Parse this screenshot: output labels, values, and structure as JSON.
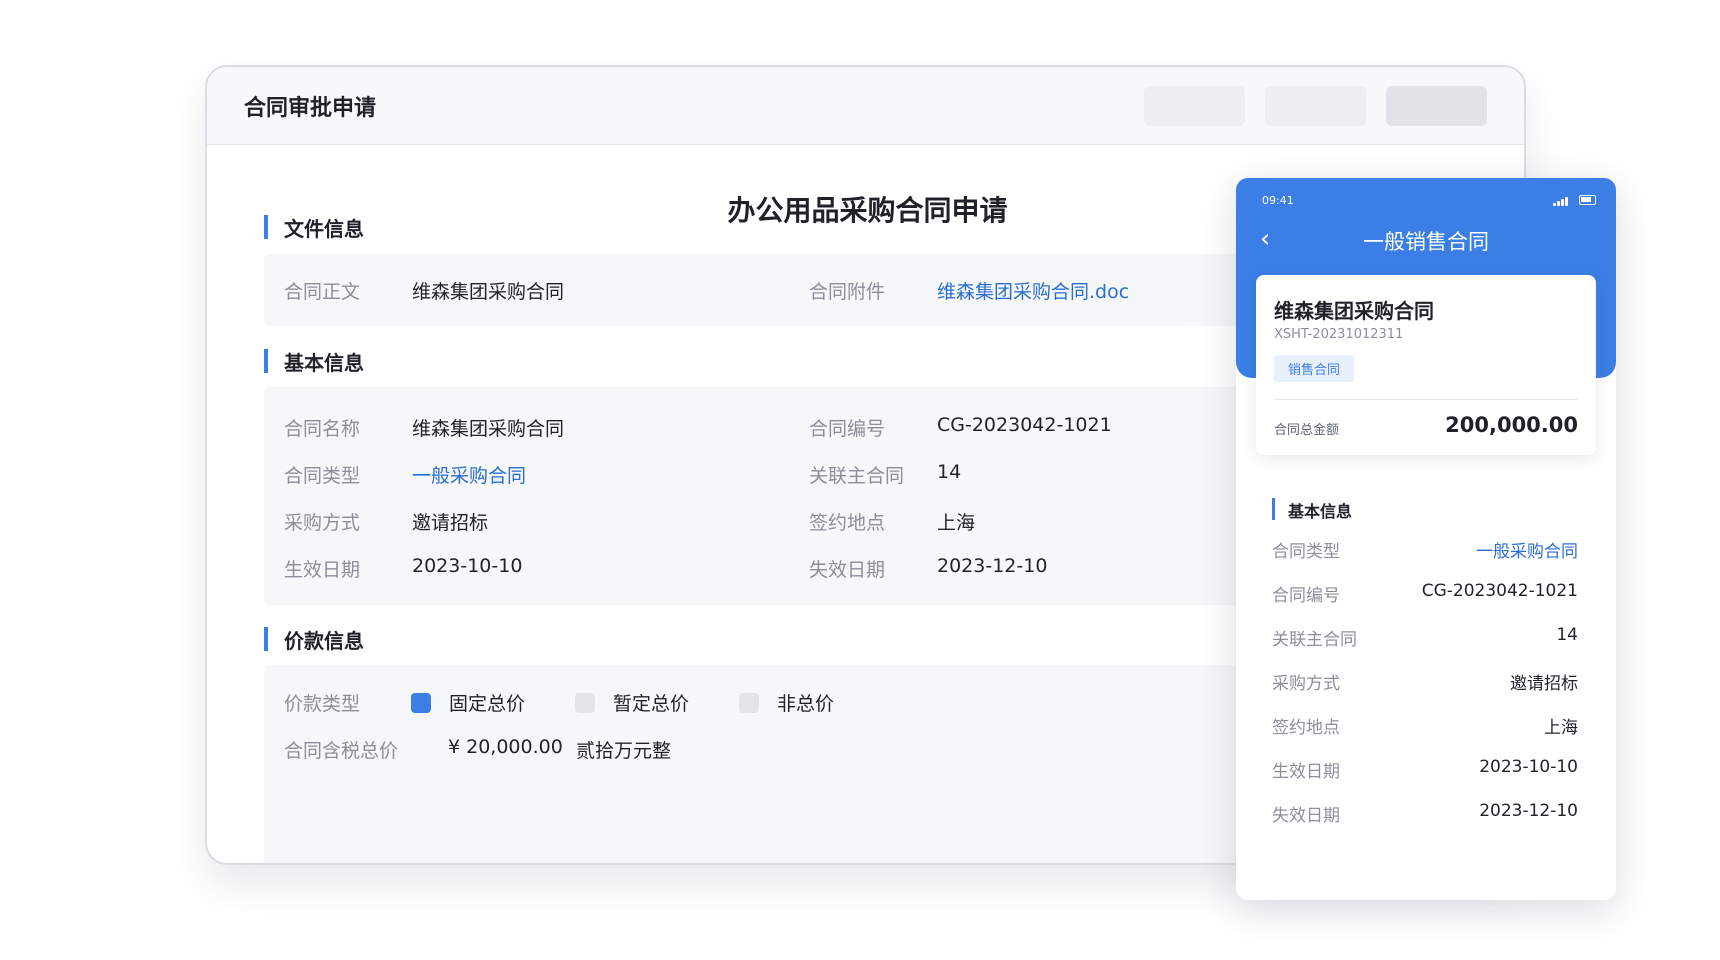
{
  "window": {
    "title": "合同审批申请",
    "doc_title": "办公用品采购合同申请"
  },
  "file_section": {
    "title": "文件信息",
    "body_label": "合同正文",
    "body_value": "维森集团采购合同",
    "attach_label": "合同附件",
    "attach_value": "维森集团采购合同.doc"
  },
  "basic_section": {
    "title": "基本信息",
    "fields": [
      {
        "label": "合同名称",
        "value": "维森集团采购合同"
      },
      {
        "label": "合同编号",
        "value": "CG-2023042-1021"
      },
      {
        "label": "合同类型",
        "value": "一般采购合同"
      },
      {
        "label": "关联主合同",
        "value": "14"
      },
      {
        "label": "采购方式",
        "value": "邀请招标"
      },
      {
        "label": "签约地点",
        "value": "上海"
      },
      {
        "label": "生效日期",
        "value": "2023-10-10"
      },
      {
        "label": "失效日期",
        "value": "2023-12-10"
      }
    ]
  },
  "price_section": {
    "title": "价款信息",
    "type_label": "价款类型",
    "options": [
      {
        "label": "固定总价",
        "checked": true
      },
      {
        "label": "暂定总价",
        "checked": false
      },
      {
        "label": "非总价",
        "checked": false
      }
    ],
    "total_label": "合同含税总价",
    "total_value": "¥ 20,000.00",
    "total_words": "贰拾万元整"
  },
  "mobile": {
    "time": "09:41",
    "title": "一般销售合同",
    "card": {
      "name": "维森集团采购合同",
      "code": "XSHT-20231012311",
      "tag": "销售合同",
      "amount_label": "合同总金额",
      "amount_value": "200,000.00"
    },
    "section_title": "基本信息",
    "rows": [
      {
        "label": "合同类型",
        "value": "一般采购合同"
      },
      {
        "label": "合同编号",
        "value": "CG-2023042-1021"
      },
      {
        "label": "关联主合同",
        "value": "14"
      },
      {
        "label": "采购方式",
        "value": "邀请招标"
      },
      {
        "label": "签约地点",
        "value": "上海"
      },
      {
        "label": "生效日期",
        "value": "2023-10-10"
      },
      {
        "label": "失效日期",
        "value": "2023-12-10"
      }
    ]
  },
  "colors": {
    "accent": "#3b7fe6",
    "link": "#2b6ed2"
  }
}
